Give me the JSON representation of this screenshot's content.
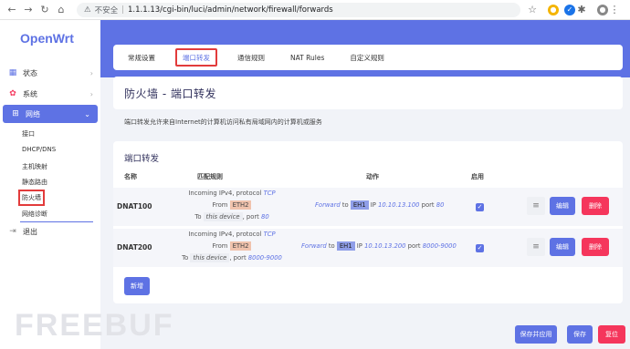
{
  "browser": {
    "security_label": "不安全",
    "url": "1.1.1.13/cgi-bin/luci/admin/network/firewall/forwards"
  },
  "sidebar": {
    "logo": "OpenWrt",
    "items": [
      {
        "label": "状态",
        "icon": "dashboard-icon"
      },
      {
        "label": "系统",
        "icon": "gear-icon"
      },
      {
        "label": "网络",
        "icon": "network-icon"
      },
      {
        "label": "退出",
        "icon": "logout-icon"
      }
    ],
    "submenu": [
      "接口",
      "DHCP/DNS",
      "主机映射",
      "静态路由",
      "防火墙",
      "网络诊断"
    ]
  },
  "tabs": [
    "常规设置",
    "端口转发",
    "通信规则",
    "NAT Rules",
    "自定义规则"
  ],
  "page": {
    "title": "防火墙 - 端口转发",
    "description": "端口转发允许来自Internet的计算机访问私有局域网内的计算机或服务"
  },
  "section": {
    "title": "端口转发",
    "headers": {
      "name": "名称",
      "match": "匹配规则",
      "action": "动作",
      "enable": "启用"
    }
  },
  "rules": [
    {
      "name": "DNAT100",
      "match_line1_prefix": "Incoming IPv4, protocol",
      "protocol": "TCP",
      "from_label": "From",
      "from_zone": "ETH2",
      "to_label": "To",
      "to_device": "this device",
      "port_label": ", port",
      "port": "80",
      "action_prefix": "Forward",
      "action_to": "to",
      "dest_zone": "EH1",
      "ip_label": "IP",
      "dest_ip": "10.10.13.100",
      "dest_port_label": "port",
      "dest_port": "80",
      "enabled": true
    },
    {
      "name": "DNAT200",
      "match_line1_prefix": "Incoming IPv4, protocol",
      "protocol": "TCP",
      "from_label": "From",
      "from_zone": "ETH2",
      "to_label": "To",
      "to_device": "this device",
      "port_label": ", port",
      "port": "8000-9000",
      "action_prefix": "Forward",
      "action_to": "to",
      "dest_zone": "EH1",
      "ip_label": "IP",
      "dest_ip": "10.10.13.200",
      "dest_port_label": "port",
      "dest_port": "8000-9000",
      "enabled": true
    }
  ],
  "buttons": {
    "edit": "编辑",
    "delete": "删除",
    "add": "新增",
    "save_apply": "保存并应用",
    "save": "保存",
    "reset": "复位"
  },
  "watermark": "FREEBUF",
  "colors": {
    "accent": "#5e72e4",
    "danger": "#f5365c"
  }
}
